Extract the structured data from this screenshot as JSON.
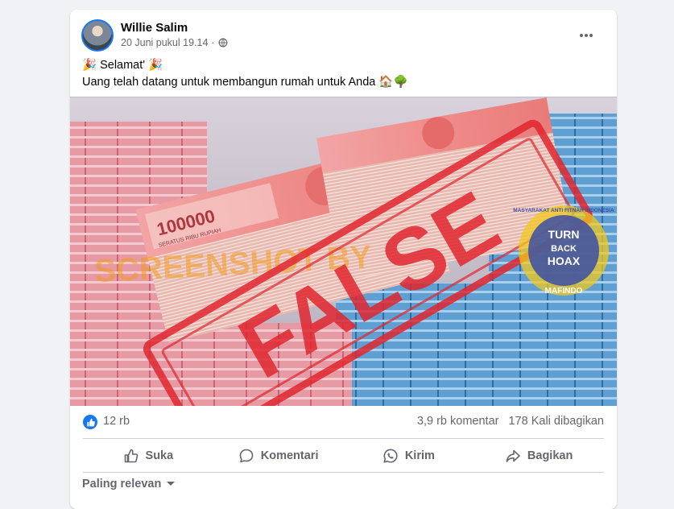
{
  "post": {
    "author": "Willie Salim",
    "timestamp": "20 Juni pukul 19.14",
    "separator": "·",
    "line1": "🎉 Selamat' 🎉",
    "line2": "Uang telah datang untuk membangun rumah untuk Anda 🏠🌳"
  },
  "image": {
    "banknote_value": "100000",
    "banknote_words": "SERATUS RIBU RUPIAH",
    "watermark": "SCREENSHOT BY",
    "stamp": "FALSE",
    "badge_line1": "TURN",
    "badge_line2": "BACK",
    "badge_line3": "HOAX",
    "badge_ring_top": "MASYARAKAT ANTI FITNAH INDONESIA",
    "badge_ring_bottom": "MAFINDO"
  },
  "engagement": {
    "reactions": "12 rb",
    "comments": "3,9 rb komentar",
    "shares": "178 Kali dibagikan"
  },
  "actions": {
    "like": "Suka",
    "comment": "Komentari",
    "send": "Kirim",
    "share": "Bagikan"
  },
  "comments_sort": "Paling relevan",
  "icons": {
    "more": "more-horizontal-icon",
    "privacy": "globe-icon",
    "like": "thumbs-up-icon",
    "comment": "speech-bubble-icon",
    "send": "whatsapp-icon",
    "share": "share-arrow-icon",
    "sort": "caret-down-icon"
  },
  "colors": {
    "brand_blue": "#1877f2",
    "stamp_red": "#e0262f",
    "watermark_orange": "#f29a1d",
    "badge_blue": "#3a4fa6",
    "badge_yellow": "#f2c81d"
  }
}
